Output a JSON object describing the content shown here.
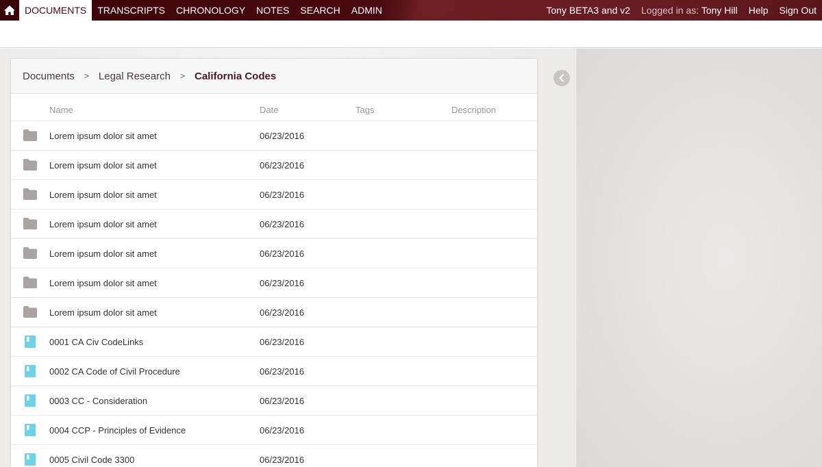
{
  "nav": {
    "tabs": [
      {
        "label": "DOCUMENTS",
        "active": true
      },
      {
        "label": "TRANSCRIPTS",
        "active": false
      },
      {
        "label": "CHRONOLOGY",
        "active": false
      },
      {
        "label": "NOTES",
        "active": false
      },
      {
        "label": "SEARCH",
        "active": false
      },
      {
        "label": "ADMIN",
        "active": false
      }
    ],
    "case_name": "Tony BETA3 and v2",
    "logged_in_label": "Logged in as:",
    "user_name": "Tony Hill",
    "help_label": "Help",
    "signout_label": "Sign Out",
    "icons": {
      "home": "home-icon",
      "collapse": "chevron-left-icon"
    }
  },
  "breadcrumb": {
    "items": [
      "Documents",
      "Legal Research",
      "California Codes"
    ],
    "separator": ">"
  },
  "table": {
    "headers": {
      "name": "Name",
      "date": "Date",
      "tags": "Tags",
      "description": "Description"
    },
    "rows": [
      {
        "type": "folder",
        "name": "Lorem ipsum dolor sit amet",
        "date": "06/23/2016"
      },
      {
        "type": "folder",
        "name": "Lorem ipsum dolor sit amet",
        "date": "06/23/2016"
      },
      {
        "type": "folder",
        "name": "Lorem ipsum dolor sit amet",
        "date": "06/23/2016"
      },
      {
        "type": "folder",
        "name": "Lorem ipsum dolor sit amet",
        "date": "06/23/2016"
      },
      {
        "type": "folder",
        "name": "Lorem ipsum dolor sit amet",
        "date": "06/23/2016"
      },
      {
        "type": "folder",
        "name": "Lorem ipsum dolor sit amet",
        "date": "06/23/2016"
      },
      {
        "type": "folder",
        "name": "Lorem ipsum dolor sit amet",
        "date": "06/23/2016"
      },
      {
        "type": "document",
        "name": "0001 CA Civ CodeLinks",
        "date": "06/23/2016"
      },
      {
        "type": "document",
        "name": "0002 CA Code of Civil Procedure",
        "date": "06/23/2016"
      },
      {
        "type": "document",
        "name": "0003 CC - Consideration",
        "date": "06/23/2016"
      },
      {
        "type": "document",
        "name": "0004 CCP - Principles of Evidence",
        "date": "06/23/2016"
      },
      {
        "type": "document",
        "name": "0005 Civil Code 3300",
        "date": "06/23/2016"
      }
    ]
  },
  "colors": {
    "brand_dark": "#4a0a0f",
    "folder_icon": "#a9a3a4",
    "document_icon": "#6fd3e8"
  }
}
